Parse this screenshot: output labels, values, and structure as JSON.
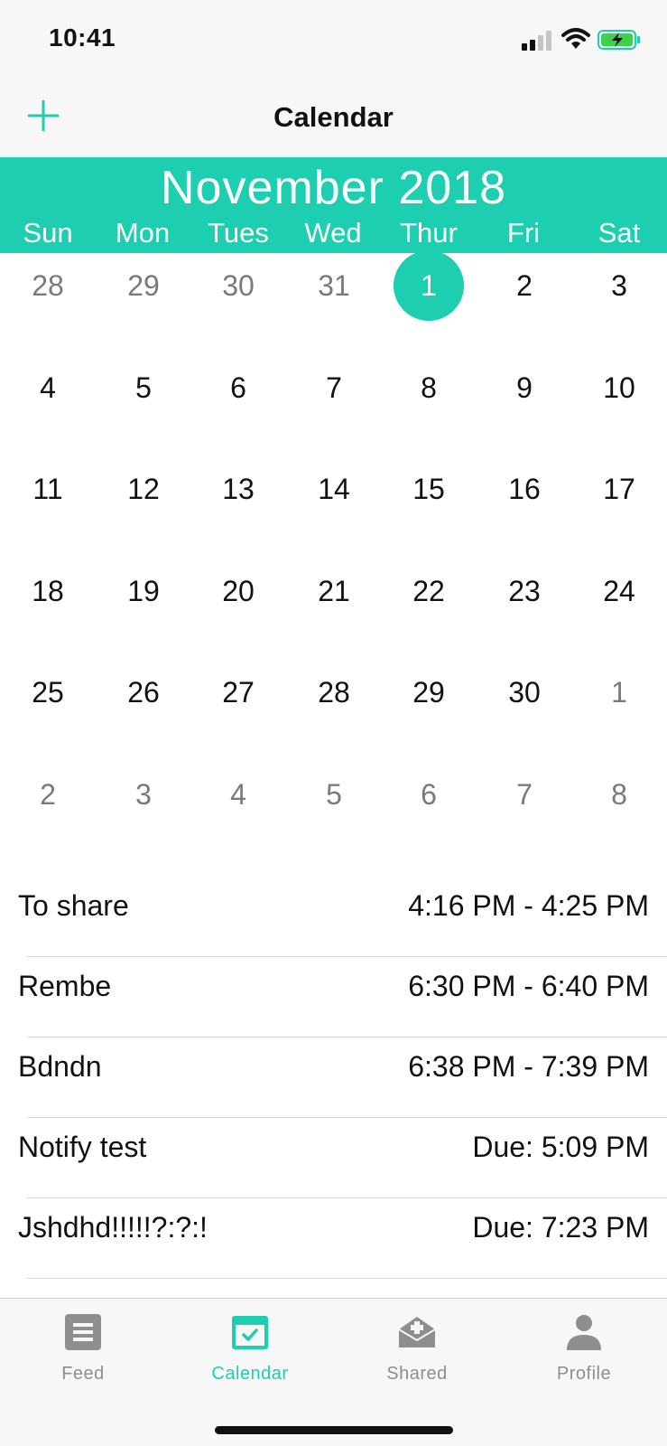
{
  "status_bar": {
    "time": "10:41"
  },
  "nav": {
    "title": "Calendar",
    "add_icon": "plus-icon"
  },
  "month": {
    "title": "November 2018"
  },
  "weekdays": [
    "Sun",
    "Mon",
    "Tues",
    "Wed",
    "Thur",
    "Fri",
    "Sat"
  ],
  "calendar": {
    "selected_day": "1",
    "weeks": [
      [
        {
          "d": "28",
          "other": true
        },
        {
          "d": "29",
          "other": true
        },
        {
          "d": "30",
          "other": true
        },
        {
          "d": "31",
          "other": true
        },
        {
          "d": "1",
          "selected": true
        },
        {
          "d": "2"
        },
        {
          "d": "3"
        }
      ],
      [
        {
          "d": "4"
        },
        {
          "d": "5"
        },
        {
          "d": "6"
        },
        {
          "d": "7"
        },
        {
          "d": "8"
        },
        {
          "d": "9"
        },
        {
          "d": "10"
        }
      ],
      [
        {
          "d": "11"
        },
        {
          "d": "12"
        },
        {
          "d": "13"
        },
        {
          "d": "14"
        },
        {
          "d": "15"
        },
        {
          "d": "16"
        },
        {
          "d": "17"
        }
      ],
      [
        {
          "d": "18"
        },
        {
          "d": "19"
        },
        {
          "d": "20"
        },
        {
          "d": "21"
        },
        {
          "d": "22"
        },
        {
          "d": "23"
        },
        {
          "d": "24"
        }
      ],
      [
        {
          "d": "25"
        },
        {
          "d": "26"
        },
        {
          "d": "27"
        },
        {
          "d": "28"
        },
        {
          "d": "29"
        },
        {
          "d": "30"
        },
        {
          "d": "1",
          "other": true
        }
      ],
      [
        {
          "d": "2",
          "other": true
        },
        {
          "d": "3",
          "other": true
        },
        {
          "d": "4",
          "other": true
        },
        {
          "d": "5",
          "other": true
        },
        {
          "d": "6",
          "other": true
        },
        {
          "d": "7",
          "other": true
        },
        {
          "d": "8",
          "other": true
        }
      ]
    ]
  },
  "events": [
    {
      "title": "To share",
      "time": "4:16 PM - 4:25 PM"
    },
    {
      "title": "Rembe",
      "time": "6:30 PM - 6:40 PM"
    },
    {
      "title": "Bdndn",
      "time": "6:38 PM - 7:39 PM"
    },
    {
      "title": "Notify test",
      "time": "Due: 5:09 PM"
    },
    {
      "title": "Jshdhd!!!!!?:?:!",
      "time": "Due: 7:23 PM"
    }
  ],
  "tabs": [
    {
      "label": "Feed",
      "icon": "feed-icon",
      "active": false
    },
    {
      "label": "Calendar",
      "icon": "calendar-icon",
      "active": true
    },
    {
      "label": "Shared",
      "icon": "shared-icon",
      "active": false
    },
    {
      "label": "Profile",
      "icon": "profile-icon",
      "active": false
    }
  ],
  "colors": {
    "accent": "#1dcfb0",
    "inactive": "#8e8e8e",
    "muted_day": "#7a7a7a"
  }
}
